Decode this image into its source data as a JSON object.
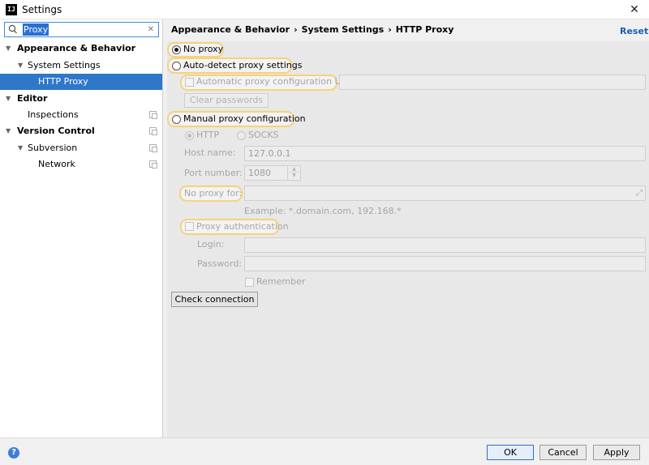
{
  "window": {
    "title": "Settings",
    "app_icon_text": "IJ"
  },
  "sidebar": {
    "search": {
      "value": "Proxy",
      "clear_icon": "✕"
    },
    "items": [
      {
        "label": "Appearance & Behavior",
        "arrow": "▼"
      },
      {
        "label": "System Settings",
        "arrow": "▼"
      },
      {
        "label": "HTTP Proxy"
      },
      {
        "label": "Editor",
        "arrow": "▼"
      },
      {
        "label": "Inspections"
      },
      {
        "label": "Version Control",
        "arrow": "▼"
      },
      {
        "label": "Subversion",
        "arrow": "▼"
      },
      {
        "label": "Network"
      }
    ]
  },
  "header": {
    "breadcrumb": [
      "Appearance & Behavior",
      "System Settings",
      "HTTP Proxy"
    ],
    "separator": "›",
    "reset_label": "Reset"
  },
  "proxy": {
    "no_proxy_label": "No proxy",
    "auto_detect_label": "Auto-detect proxy settings",
    "auto_config_url_label": "Automatic proxy configuration URL:",
    "auto_config_url_value": "",
    "clear_passwords_label": "Clear passwords",
    "manual_label": "Manual proxy configuration",
    "http_label": "HTTP",
    "socks_label": "SOCKS",
    "host_name_label": "Host name:",
    "host_name_value": "127.0.0.1",
    "port_number_label": "Port number:",
    "port_number_value": "1080",
    "no_proxy_for_label": "No proxy for:",
    "no_proxy_for_value": "",
    "example_text": "Example: *.domain.com, 192.168.*",
    "proxy_auth_label": "Proxy authentication",
    "login_label": "Login:",
    "login_value": "",
    "password_label": "Password:",
    "password_value": "",
    "remember_label": "Remember",
    "check_connection_label": "Check connection"
  },
  "footer": {
    "help_icon_text": "?",
    "ok_label": "OK",
    "cancel_label": "Cancel",
    "apply_label": "Apply"
  },
  "colors": {
    "selection": "#2e77c9",
    "highlight_ring": "#f7d27a",
    "link": "#1a5fb4",
    "primary_button_border": "#2f6fc8"
  }
}
